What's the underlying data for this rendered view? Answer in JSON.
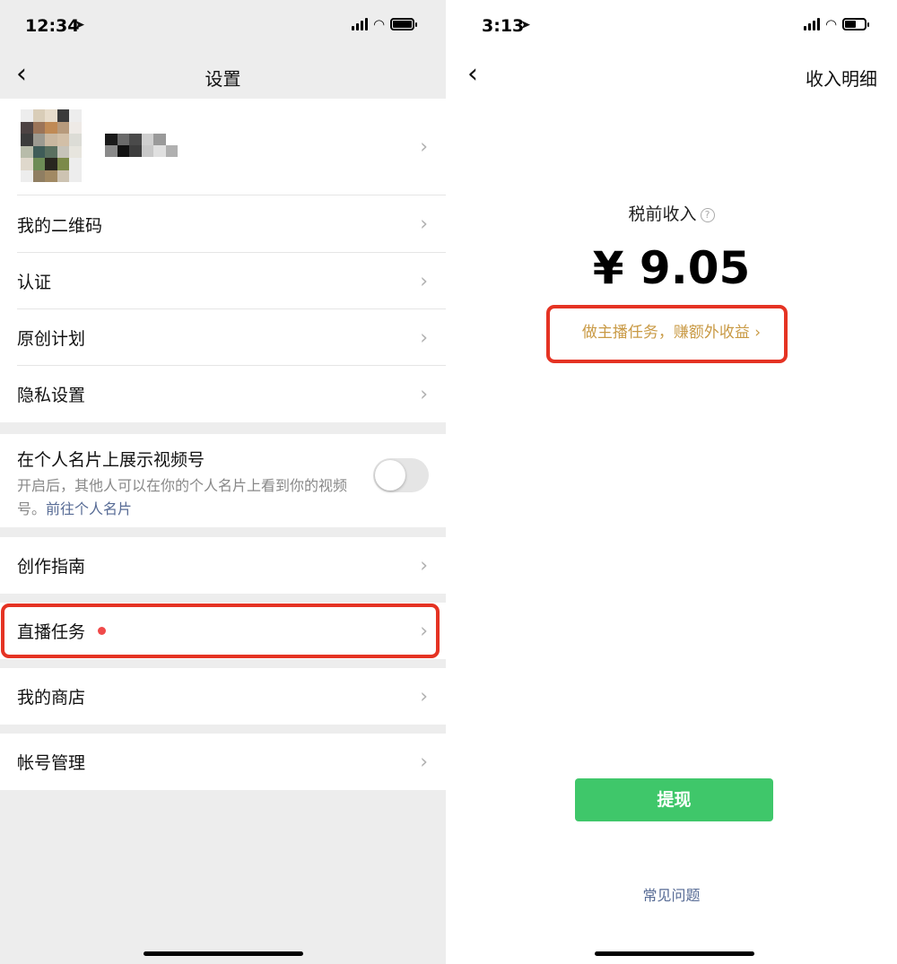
{
  "left": {
    "status_time": "12:34",
    "title": "设置",
    "menu": {
      "qrcode": "我的二维码",
      "verify": "认证",
      "original": "原创计划",
      "privacy": "隐私设置",
      "show_on_card": "在个人名片上展示视频号",
      "show_on_card_desc": "开启后，其他人可以在你的个人名片上看到你的视频号。",
      "show_on_card_link": "前往个人名片",
      "show_on_card_enabled": false,
      "guide": "创作指南",
      "live_task": "直播任务",
      "store": "我的商店",
      "account": "帐号管理"
    }
  },
  "right": {
    "status_time": "3:13",
    "nav_right": "收入明细",
    "income_label": "税前收入",
    "amount": "¥ 9.05",
    "task_link": "做主播任务，赚额外收益 ›",
    "withdraw": "提现",
    "faq": "常见问题"
  },
  "colors": {
    "highlight": "#e53323",
    "accent_green": "#3fc76a",
    "link_blue": "#576b95",
    "task_gold": "#c99a45",
    "red_dot": "#f04a4a"
  }
}
